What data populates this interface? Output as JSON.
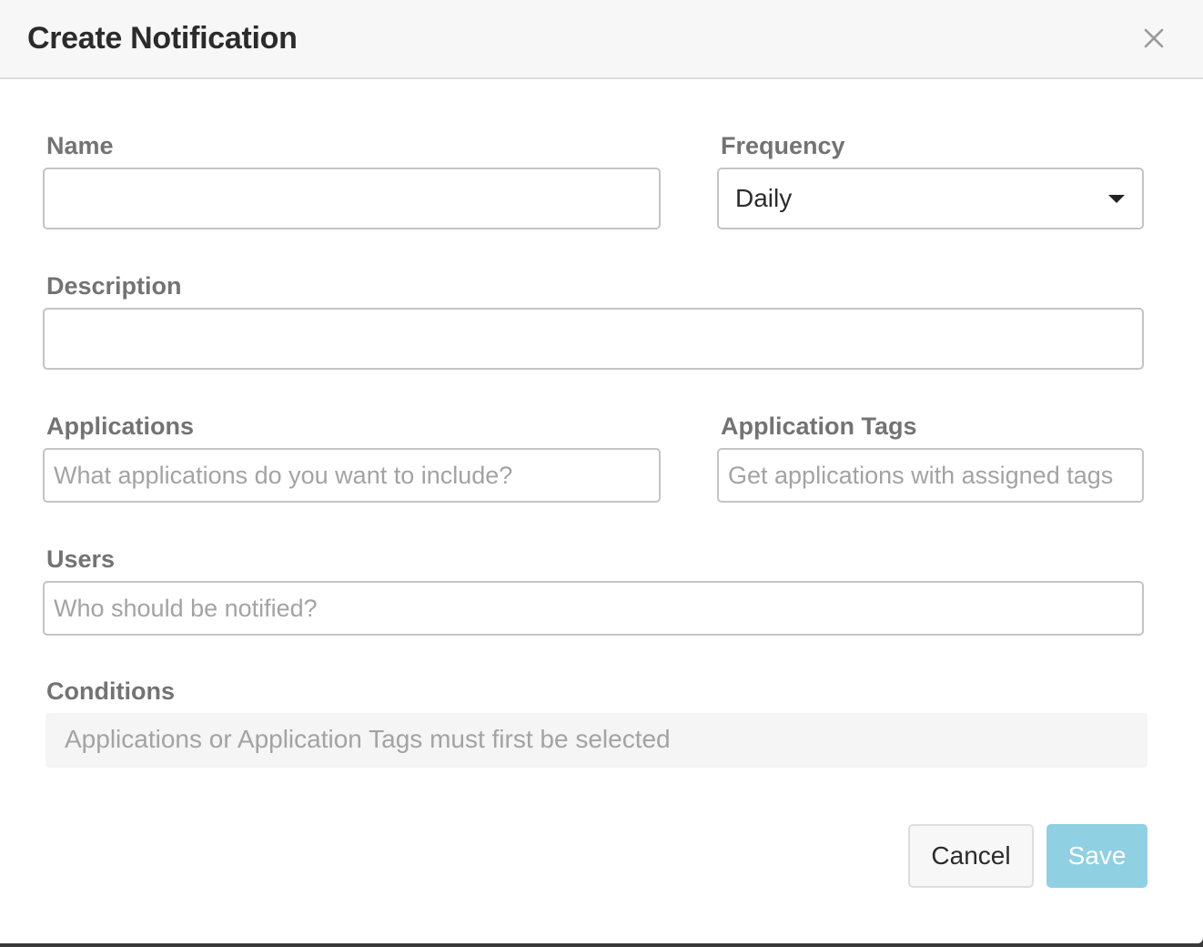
{
  "dialog": {
    "title": "Create Notification",
    "close_icon": "close-icon"
  },
  "form": {
    "name": {
      "label": "Name",
      "value": "",
      "placeholder": ""
    },
    "frequency": {
      "label": "Frequency",
      "selected": "Daily",
      "icon": "caret-down-icon"
    },
    "description": {
      "label": "Description",
      "value": "",
      "placeholder": ""
    },
    "applications": {
      "label": "Applications",
      "value": "",
      "placeholder": "What applications do you want to include?"
    },
    "application_tags": {
      "label": "Application Tags",
      "value": "",
      "placeholder": "Get applications with assigned tags"
    },
    "users": {
      "label": "Users",
      "value": "",
      "placeholder": "Who should be notified?"
    },
    "conditions": {
      "label": "Conditions",
      "message": "Applications or Application Tags must first be selected"
    }
  },
  "actions": {
    "cancel_label": "Cancel",
    "save_label": "Save"
  },
  "colors": {
    "save_button_disabled": "#8fd0e3",
    "label_text": "#737373",
    "placeholder_text": "#a3a3a3",
    "header_bg": "#f7f7f7"
  }
}
